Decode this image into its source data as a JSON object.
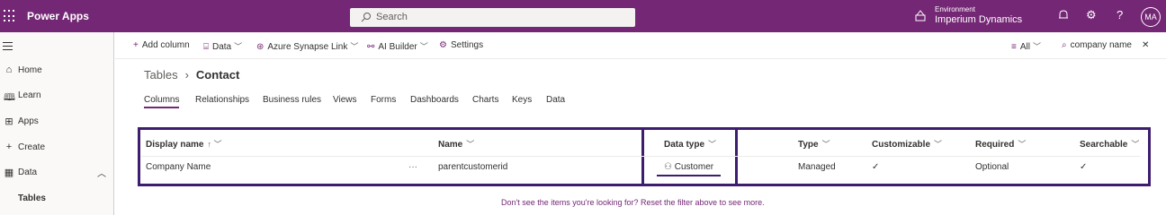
{
  "topbar": {
    "app_title": "Power Apps",
    "search_placeholder": "Search",
    "env_label": "Environment",
    "env_name": "Imperium Dynamics",
    "avatar_initials": "MA",
    "color": "#742774"
  },
  "sidebar": {
    "items": [
      {
        "label": "Home",
        "icon": "home-icon"
      },
      {
        "label": "Learn",
        "icon": "book-icon"
      },
      {
        "label": "Apps",
        "icon": "apps-icon"
      },
      {
        "label": "Create",
        "icon": "plus-icon"
      },
      {
        "label": "Data",
        "icon": "table-icon"
      },
      {
        "label": "Tables"
      }
    ]
  },
  "commandbar": {
    "add_column": "Add column",
    "data": "Data",
    "azure": "Azure Synapse Link",
    "ai_builder": "AI Builder",
    "settings": "Settings",
    "filter": "All",
    "search_value": "company name"
  },
  "breadcrumb": {
    "root": "Tables",
    "current": "Contact"
  },
  "tabs": [
    "Columns",
    "Relationships",
    "Business rules",
    "Views",
    "Forms",
    "Dashboards",
    "Charts",
    "Keys",
    "Data"
  ],
  "grid": {
    "headers": {
      "display_name": "Display name",
      "name": "Name",
      "data_type": "Data type",
      "type": "Type",
      "customizable": "Customizable",
      "required": "Required",
      "searchable": "Searchable"
    },
    "rows": [
      {
        "display_name": "Company Name",
        "name": "parentcustomerid",
        "data_type": "Customer",
        "type": "Managed",
        "customizable": "✓",
        "required": "Optional",
        "searchable": "✓"
      }
    ]
  },
  "footer_text": "Don't see the items you're looking for? Reset the filter above to see more.",
  "highlight_color": "#3d1d6e"
}
